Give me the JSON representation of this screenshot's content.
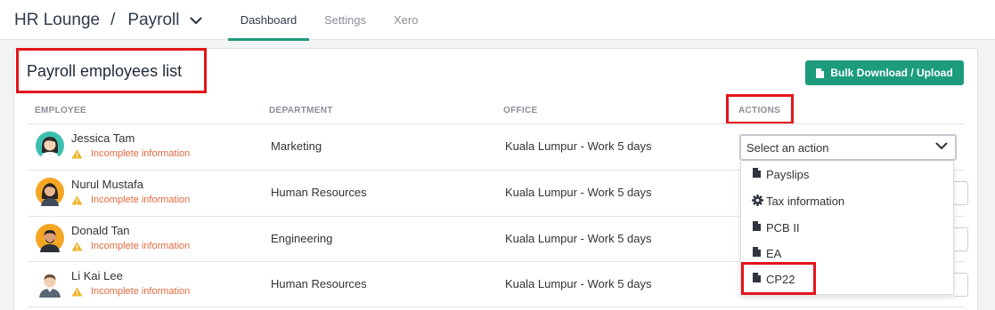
{
  "header": {
    "app_name": "HR Lounge",
    "separator": "/",
    "module": "Payroll",
    "tabs": [
      {
        "label": "Dashboard",
        "active": true
      },
      {
        "label": "Settings",
        "active": false
      },
      {
        "label": "Xero",
        "active": false
      }
    ]
  },
  "card": {
    "title": "Payroll employees list",
    "bulk_button_label": "Bulk Download / Upload",
    "columns": {
      "employee": "EMPLOYEE",
      "department": "DEPARTMENT",
      "office": "OFFICE",
      "actions": "ACTIONS"
    }
  },
  "employees": [
    {
      "name": "Jessica Tam",
      "status": "Incomplete information",
      "department": "Marketing",
      "office": "Kuala Lumpur - Work 5 days",
      "avatar_icon": "female-avatar-icon"
    },
    {
      "name": "Nurul Mustafa",
      "status": "Incomplete information",
      "department": "Human Resources",
      "office": "Kuala Lumpur - Work 5 days",
      "avatar_icon": "female-avatar-icon"
    },
    {
      "name": "Donald Tan",
      "status": "Incomplete information",
      "department": "Engineering",
      "office": "Kuala Lumpur - Work 5 days",
      "avatar_icon": "male-avatar-icon"
    },
    {
      "name": "Li Kai Lee",
      "status": "Incomplete information",
      "department": "Human Resources",
      "office": "Kuala Lumpur - Work 5 days",
      "avatar_icon": "male-avatar-icon"
    }
  ],
  "action_select": {
    "placeholder": "Select an action",
    "options": [
      {
        "label": "Payslips",
        "icon": "file-icon"
      },
      {
        "label": "Tax information",
        "icon": "gear-icon"
      },
      {
        "label": "PCB II",
        "icon": "file-icon"
      },
      {
        "label": "EA",
        "icon": "file-icon"
      },
      {
        "label": "CP22",
        "icon": "file-icon"
      }
    ]
  },
  "colors": {
    "accent": "#1c9c7c",
    "warning_text": "#e26a3e",
    "warning_icon": "#f0b429",
    "highlight": "#e3141a"
  }
}
